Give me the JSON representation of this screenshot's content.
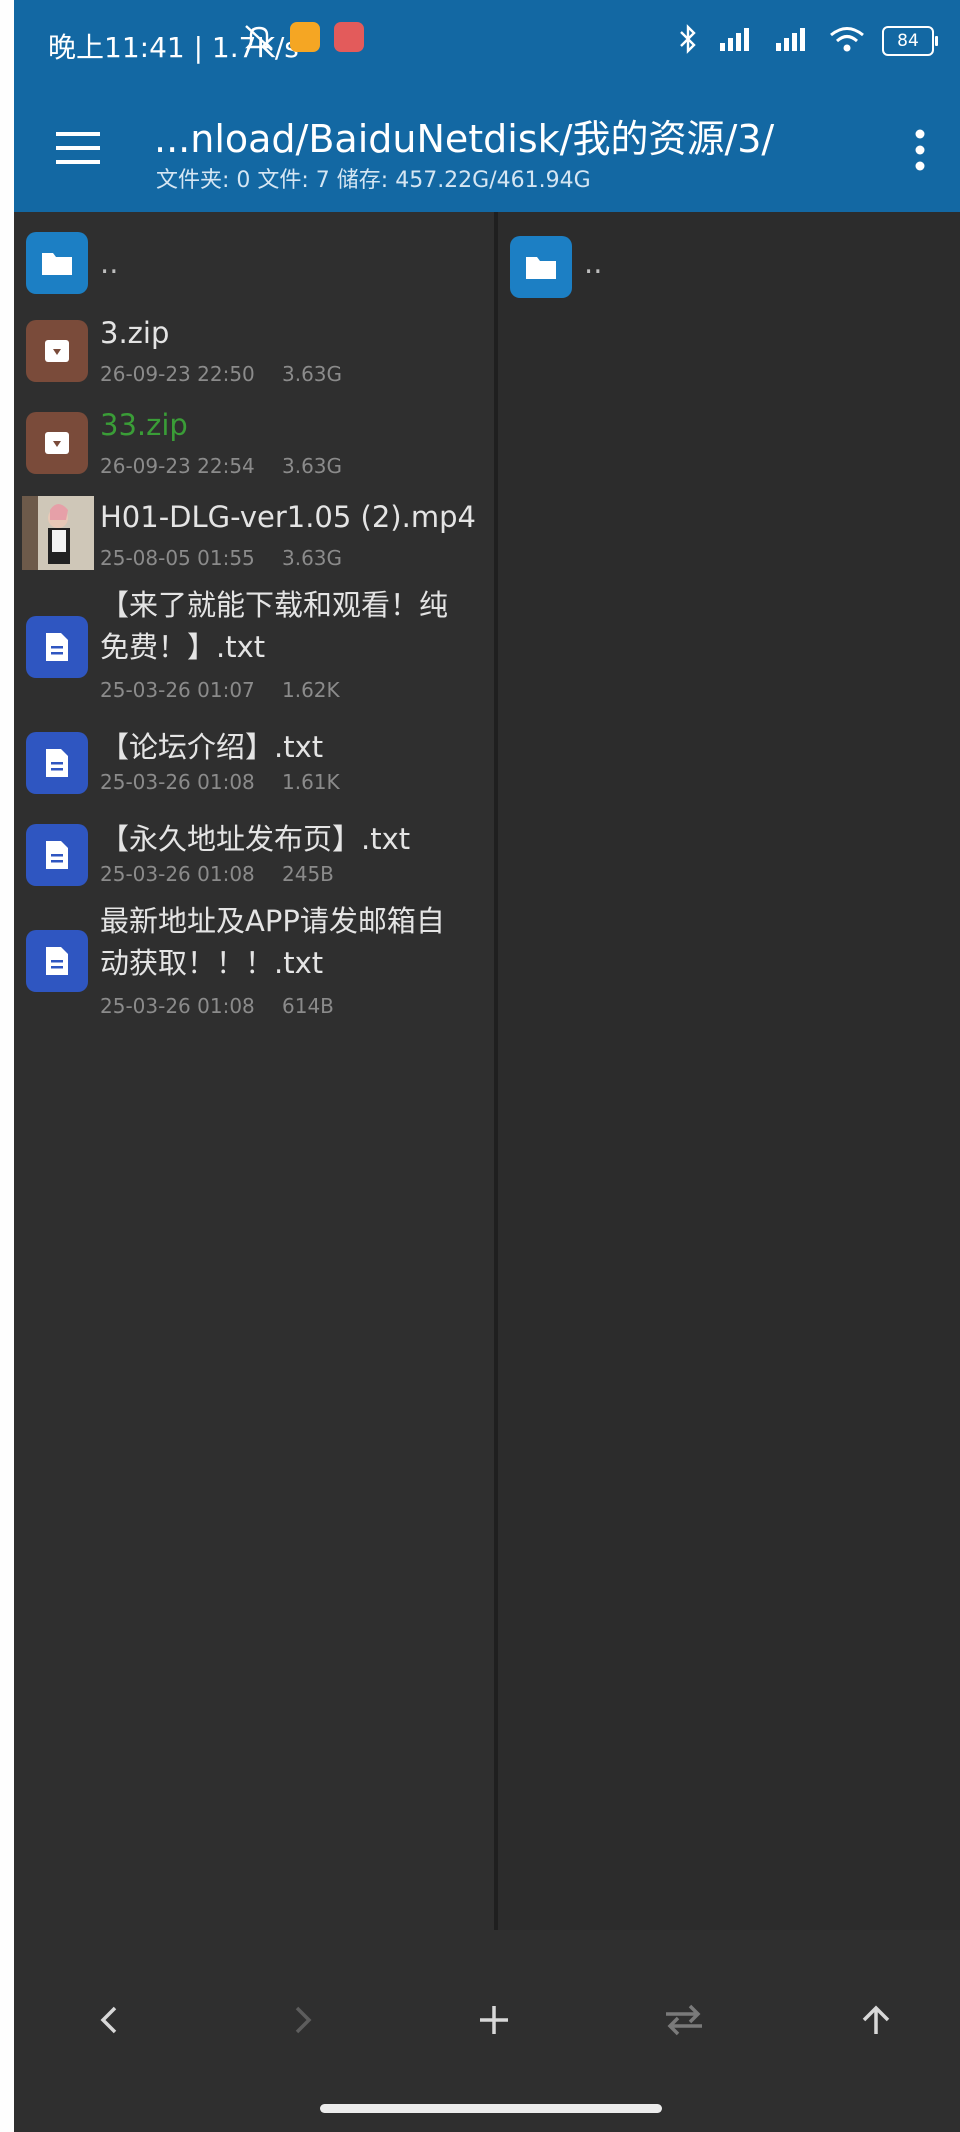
{
  "status_bar": {
    "time_speed": "晚上11:41 | 1.7K/s",
    "battery": "84",
    "icons": [
      "mute-icon",
      "app-notification-icon",
      "app-notification-icon",
      "bluetooth-icon",
      "signal-icon",
      "signal-icon",
      "wifi-icon",
      "battery-icon"
    ]
  },
  "toolbar": {
    "path": "...nload/BaiduNetdisk/我的资源/3/",
    "info": "文件夹: 0  文件: 7  储存: 457.22G/461.94G",
    "menu_icon": "hamburger-icon",
    "more_icon": "more-vert-icon"
  },
  "left_pane": {
    "items": [
      {
        "type": "folder",
        "name": ".."
      },
      {
        "type": "zip",
        "name": "3.zip",
        "date": "26-09-23 22:50",
        "size": "3.63G"
      },
      {
        "type": "zip",
        "name": "33.zip",
        "date": "26-09-23 22:54",
        "size": "3.63G",
        "highlight": true
      },
      {
        "type": "video",
        "name": "H01-DLG-ver1.05 (2).mp4",
        "date": "25-08-05 01:55",
        "size": "3.63G"
      },
      {
        "type": "txt",
        "name": "【来了就能下载和观看！纯免费！】.txt",
        "date": "25-03-26 01:07",
        "size": "1.62K"
      },
      {
        "type": "txt",
        "name": "【论坛介绍】.txt",
        "date": "25-03-26 01:08",
        "size": "1.61K"
      },
      {
        "type": "txt",
        "name": "【永久地址发布页】.txt",
        "date": "25-03-26 01:08",
        "size": "245B"
      },
      {
        "type": "txt",
        "name": "最新地址及APP请发邮箱自动获取！！！.txt",
        "date": "25-03-26 01:08",
        "size": "614B"
      }
    ]
  },
  "right_pane": {
    "items": [
      {
        "type": "folder",
        "name": ".."
      }
    ]
  },
  "bottom_nav": {
    "buttons": [
      "back-icon",
      "forward-icon",
      "add-icon",
      "swap-icon",
      "up-icon"
    ]
  },
  "colors": {
    "header": "#1368a3",
    "background": "#2c2c2c",
    "folder": "#1c7fc4",
    "zip": "#7a4b3a",
    "txt": "#2f56c1",
    "highlight_text": "#3a9d37"
  }
}
